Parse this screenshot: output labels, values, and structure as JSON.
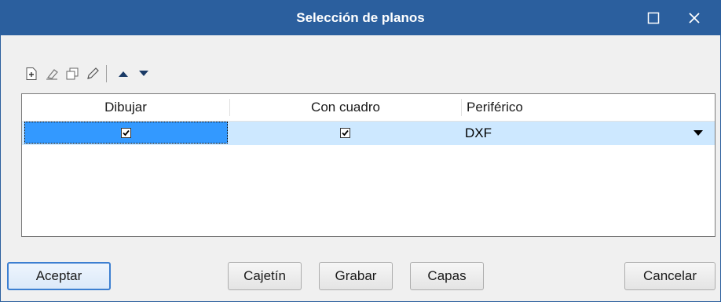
{
  "window": {
    "title": "Selección de planos"
  },
  "toolbar": {
    "buttons": [
      {
        "icon": "add-icon"
      },
      {
        "icon": "eraser-icon"
      },
      {
        "icon": "copy-icon"
      },
      {
        "icon": "pencil-icon"
      },
      {
        "icon": "move-up-icon"
      },
      {
        "icon": "move-down-icon"
      }
    ]
  },
  "grid": {
    "columns": [
      "Dibujar",
      "Con cuadro",
      "Periférico"
    ],
    "rows": [
      {
        "dibujar": true,
        "con_cuadro": true,
        "periferico": "DXF"
      }
    ]
  },
  "buttons": {
    "accept": "Aceptar",
    "cajetin": "Cajetín",
    "save": "Grabar",
    "layers": "Capas",
    "cancel": "Cancelar"
  },
  "colors": {
    "titlebar": "#2b5f9e",
    "row_highlight": "#cde8ff",
    "cell_selected": "#3399ff"
  }
}
